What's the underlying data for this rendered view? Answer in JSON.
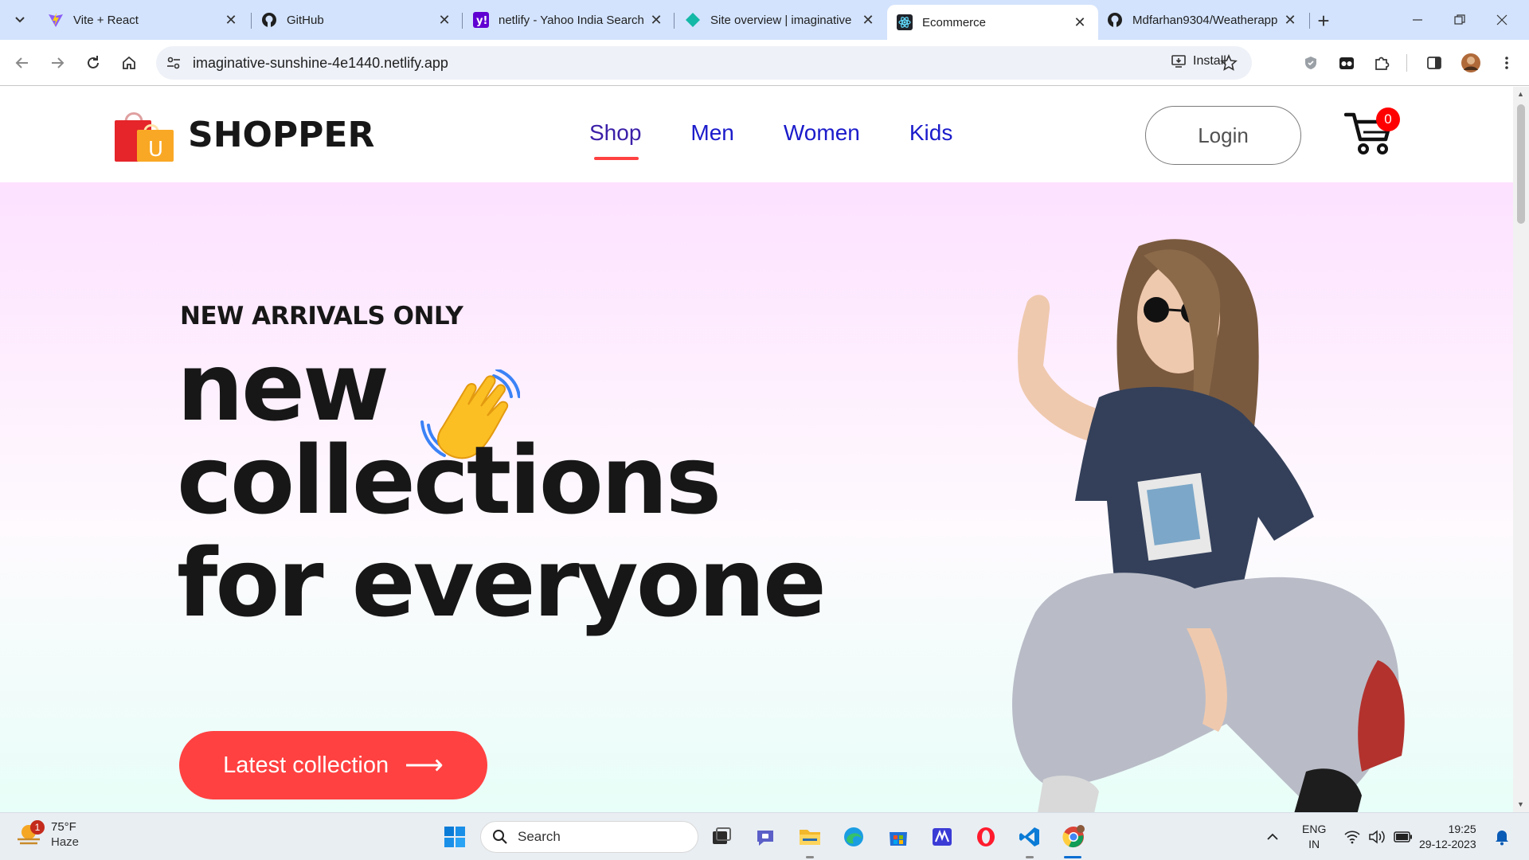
{
  "browser": {
    "tabs": [
      {
        "title": "Vite + React",
        "icon": "vite-icon",
        "active": false
      },
      {
        "title": "GitHub",
        "icon": "github-icon",
        "active": false
      },
      {
        "title": "netlify - Yahoo India Search",
        "icon": "yahoo-icon",
        "active": false
      },
      {
        "title": "Site overview | imaginative",
        "icon": "netlify-icon",
        "active": false
      },
      {
        "title": "Ecommerce",
        "icon": "react-icon",
        "active": true
      },
      {
        "title": "Mdfarhan9304/Weatherapp",
        "icon": "github-icon",
        "active": false
      }
    ],
    "url": "imaginative-sunshine-4e1440.netlify.app",
    "install_label": "Install",
    "colors": {
      "tabbar": "#d3e3fd",
      "omnibox": "#eef1f8"
    }
  },
  "site": {
    "brand": "SHOPPER",
    "logo_letter": "U",
    "nav": [
      {
        "label": "Shop",
        "active": true
      },
      {
        "label": "Men",
        "active": false
      },
      {
        "label": "Women",
        "active": false
      },
      {
        "label": "Kids",
        "active": false
      }
    ],
    "login_label": "Login",
    "cart_count": "0",
    "hero": {
      "kicker": "NEW ARRIVALS ONLY",
      "line1": "new",
      "line2": "collections",
      "line3": "for everyone",
      "cta_label": "Latest collection",
      "cta_arrow": "⟶"
    },
    "colors": {
      "accent": "#ff4141",
      "nav_link": "#1b1bcb",
      "text": "#171717"
    }
  },
  "taskbar": {
    "weather_temp": "75°F",
    "weather_condition": "Haze",
    "weather_badge": "1",
    "search_placeholder": "Search",
    "language_line1": "ENG",
    "language_line2": "IN",
    "time": "19:25",
    "date": "29-12-2023"
  }
}
